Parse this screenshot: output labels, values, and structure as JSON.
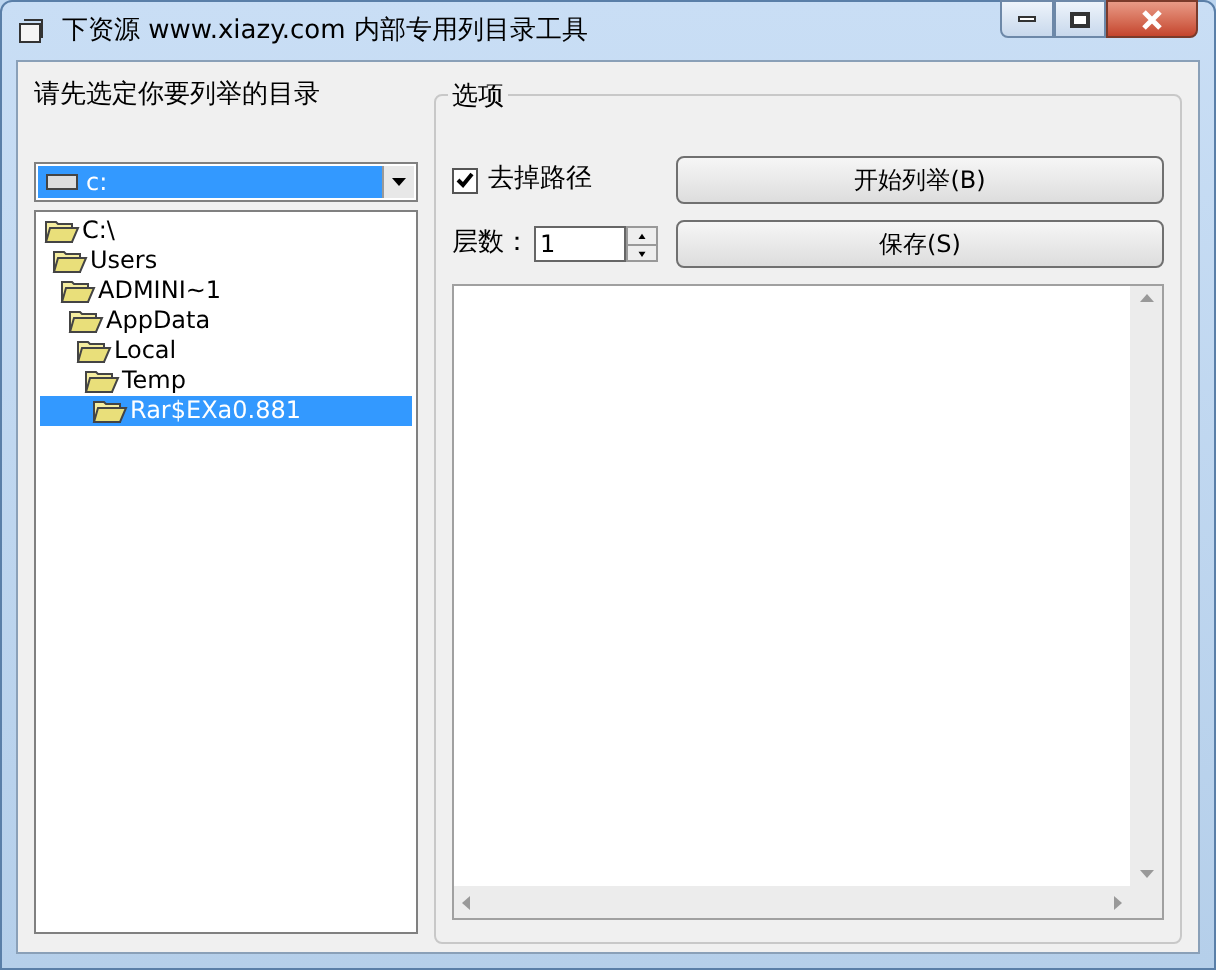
{
  "window": {
    "title": "下资源 www.xiazy.com 内部专用列目录工具"
  },
  "left": {
    "label": "请先选定你要列举的目录",
    "drive": {
      "value": "c:"
    },
    "tree": [
      {
        "label": "C:\\",
        "selected": false,
        "children": [
          {
            "label": "Users",
            "selected": false,
            "children": [
              {
                "label": "ADMINI~1",
                "selected": false,
                "children": [
                  {
                    "label": "AppData",
                    "selected": false,
                    "children": [
                      {
                        "label": "Local",
                        "selected": false,
                        "children": [
                          {
                            "label": "Temp",
                            "selected": false,
                            "children": [
                              {
                                "label": "Rar$EXa0.881",
                                "selected": true
                              }
                            ]
                          }
                        ]
                      }
                    ]
                  }
                ]
              }
            ]
          }
        ]
      }
    ]
  },
  "options": {
    "title": "选项",
    "strip_path": {
      "label": "去掉路径",
      "checked": true
    },
    "start_button": "开始列举(B)",
    "levels": {
      "label": "层数：",
      "value": "1"
    },
    "save_button": "保存(S)"
  }
}
